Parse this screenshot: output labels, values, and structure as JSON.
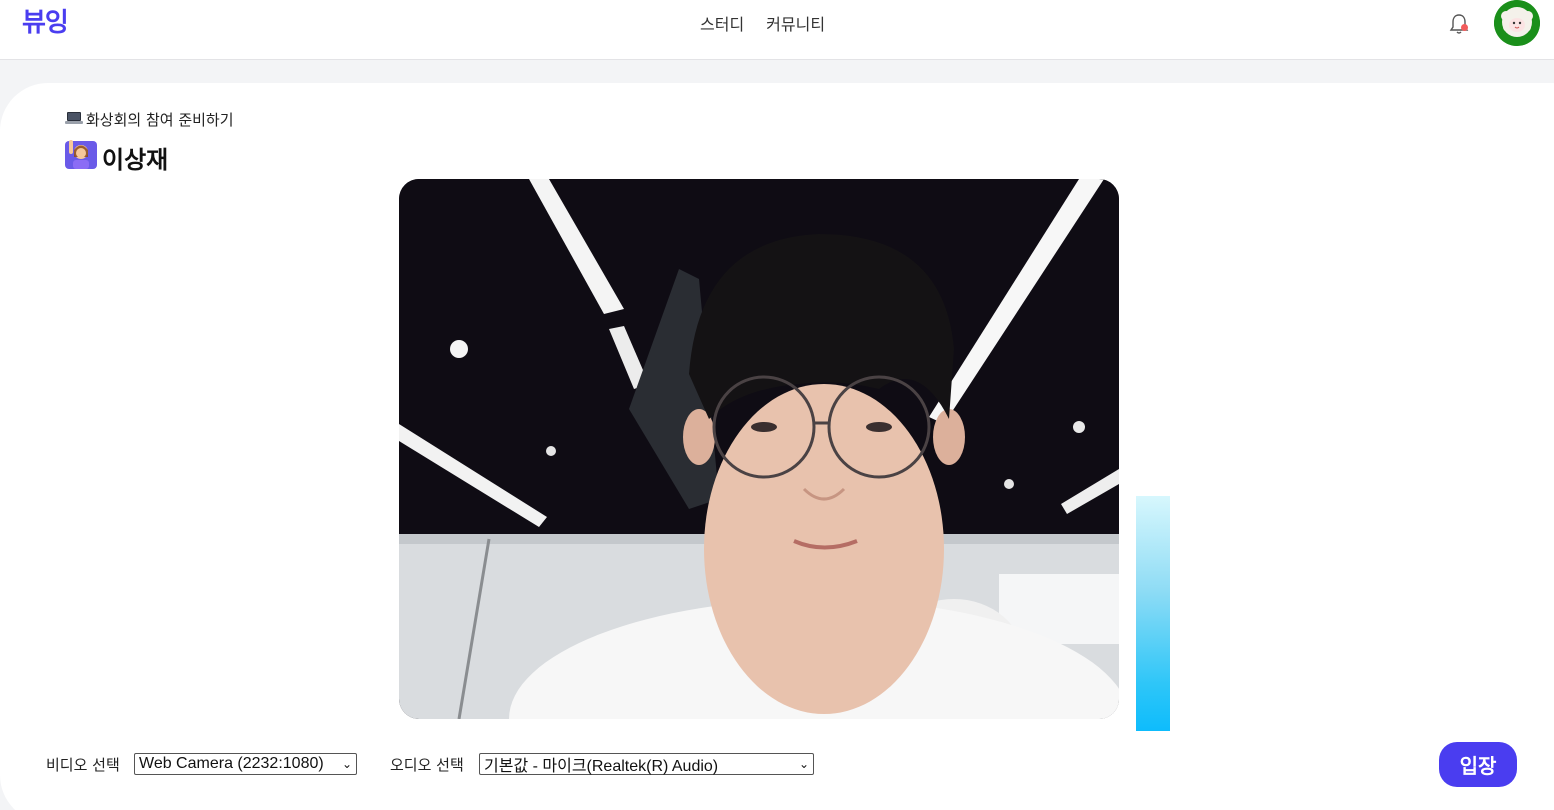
{
  "header": {
    "logo": "뷰잉",
    "nav": [
      "스터디",
      "커뮤니티"
    ]
  },
  "prep": {
    "subtitle": "화상회의 참여 준비하기",
    "user_name": "이상재"
  },
  "audio_level": 1.0,
  "controls": {
    "video_label": "비디오 선택",
    "video_selected": "Web Camera (2232:1080)",
    "audio_label": "오디오 선택",
    "audio_selected": "기본값 - 마이크(Realtek(R) Audio)",
    "enter_label": "입장"
  },
  "colors": {
    "brand": "#4a3df0",
    "meter": "#0ebcfc",
    "notification_dot": "#f25c5c"
  }
}
